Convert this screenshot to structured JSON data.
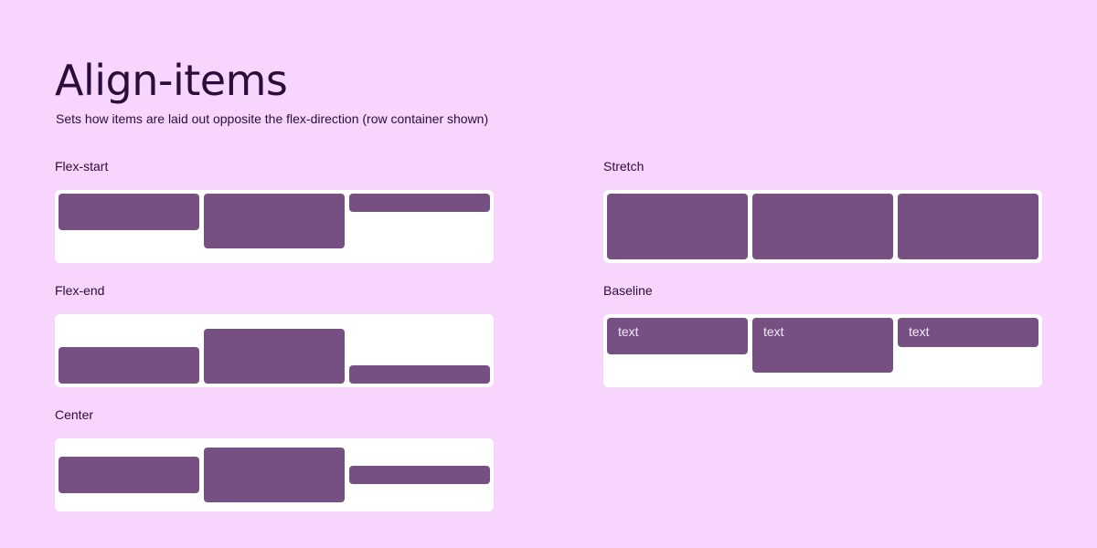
{
  "header": {
    "title": "Align-items",
    "subtitle": "Sets how items are laid out opposite the flex-direction (row container shown)"
  },
  "colors": {
    "background": "#f7d5fd",
    "container": "#ffffff",
    "item": "#775083",
    "text": "#2a0d3a"
  },
  "examples": {
    "flex_start": {
      "label": "Flex-start",
      "value": "flex-start"
    },
    "flex_end": {
      "label": "Flex-end",
      "value": "flex-end"
    },
    "center": {
      "label": "Center",
      "value": "center"
    },
    "stretch": {
      "label": "Stretch",
      "value": "stretch"
    },
    "baseline": {
      "label": "Baseline",
      "value": "baseline",
      "item_texts": [
        "text",
        "text",
        "text"
      ]
    }
  }
}
